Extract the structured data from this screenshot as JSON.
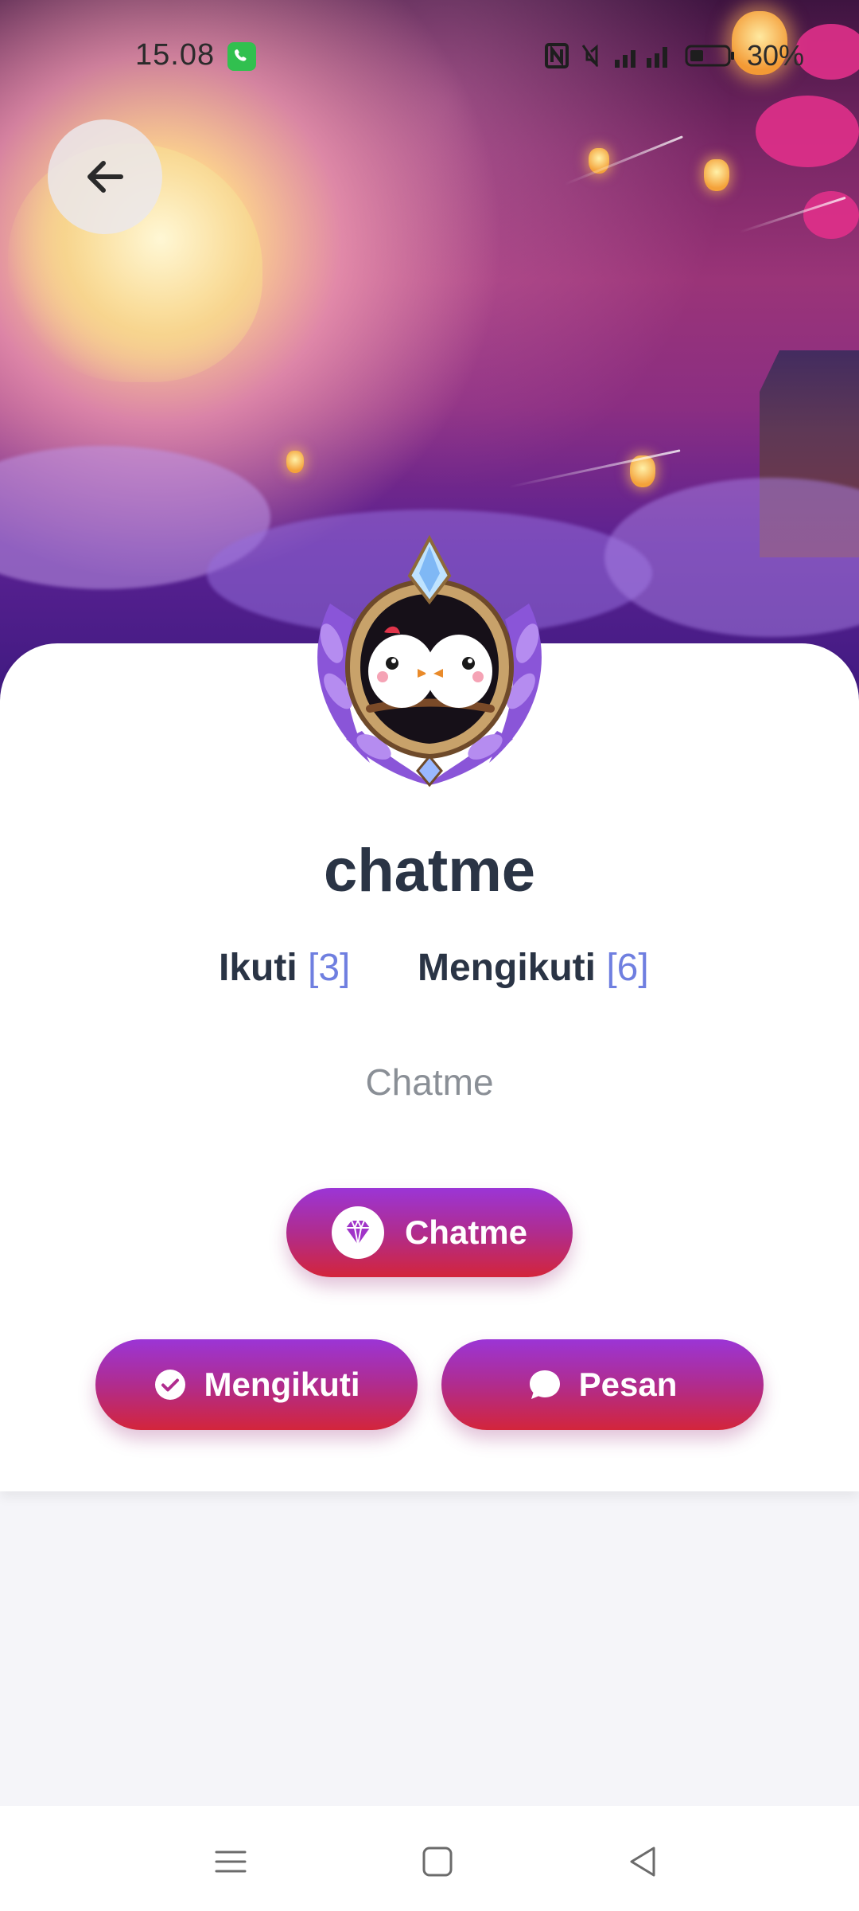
{
  "status_bar": {
    "time": "15.08",
    "battery": "30%",
    "icons": [
      "phone-call-icon",
      "nfc-icon",
      "mute-icon",
      "signal-icon",
      "battery-icon"
    ]
  },
  "header": {
    "back_icon": "arrow-left-icon"
  },
  "profile": {
    "username": "chatme",
    "ikuti_label": "Ikuti",
    "ikuti_count": "[3]",
    "mengikuti_label": "Mengikuti",
    "mengikuti_count": "[6]",
    "bio": "Chatme",
    "avatar_icon": "lovebirds-frame-avatar"
  },
  "actions": {
    "vip_label": "Chatme",
    "vip_icon": "diamond-icon",
    "follow_label": "Mengikuti",
    "follow_icon": "check-circle-icon",
    "message_label": "Pesan",
    "message_icon": "chat-bubble-icon"
  },
  "navigation": {
    "icons": [
      "menu-icon",
      "home-square-icon",
      "back-triangle-icon"
    ]
  },
  "colors": {
    "primary_text": "#2a3445",
    "count_accent": "#6f7fe0",
    "button_gradient_top": "#9b35d6",
    "button_gradient_bottom": "#d3253b",
    "muted_text": "#8a8f96"
  }
}
